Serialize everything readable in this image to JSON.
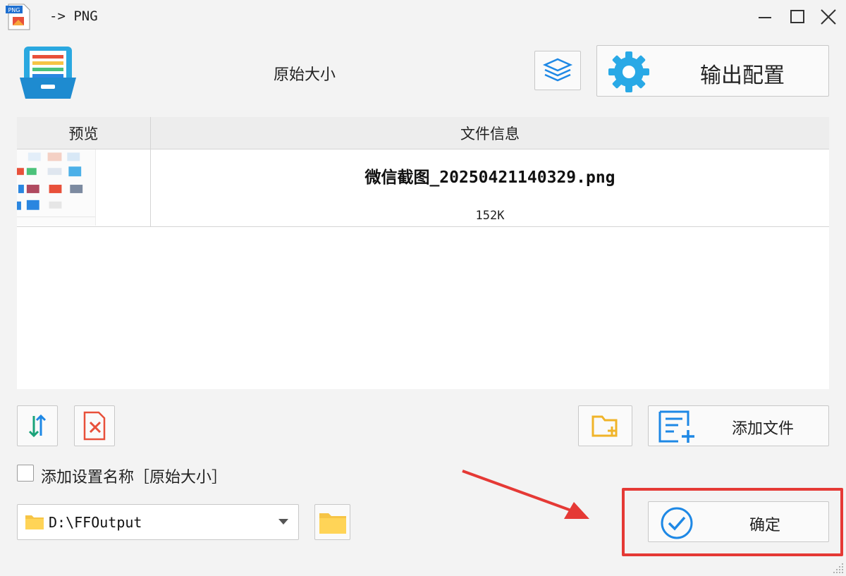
{
  "window": {
    "title": "-> PNG",
    "app_icon_badge": "PNG",
    "controls": [
      "minimize-icon",
      "maximize-icon",
      "close-icon"
    ]
  },
  "header": {
    "title": "原始大小",
    "layers_icon": "layers-icon",
    "config_button_label": "输出配置",
    "config_icon": "gear-icon"
  },
  "file_list": {
    "columns": {
      "preview": "预览",
      "info": "文件信息"
    },
    "rows": [
      {
        "filename": "微信截图_20250421140329.png",
        "size": "152K"
      }
    ]
  },
  "toolbar": {
    "sort_icon": "sort-arrows-icon",
    "clear_icon": "delete-file-icon",
    "add_folder_icon": "add-folder-icon",
    "add_file_label": "添加文件",
    "add_file_icon": "add-list-icon"
  },
  "options": {
    "add_setting_name_label": "添加设置名称［原始大小］",
    "add_setting_name_checked": false
  },
  "output": {
    "path": "D:\\FFOutput",
    "folder_icon": "folder-icon"
  },
  "confirm": {
    "label": "确定",
    "icon": "check-circle-icon"
  },
  "colors": {
    "accent_blue": "#1e88e5",
    "highlight_red": "#e53935",
    "folder_yellow": "#f6c445"
  }
}
